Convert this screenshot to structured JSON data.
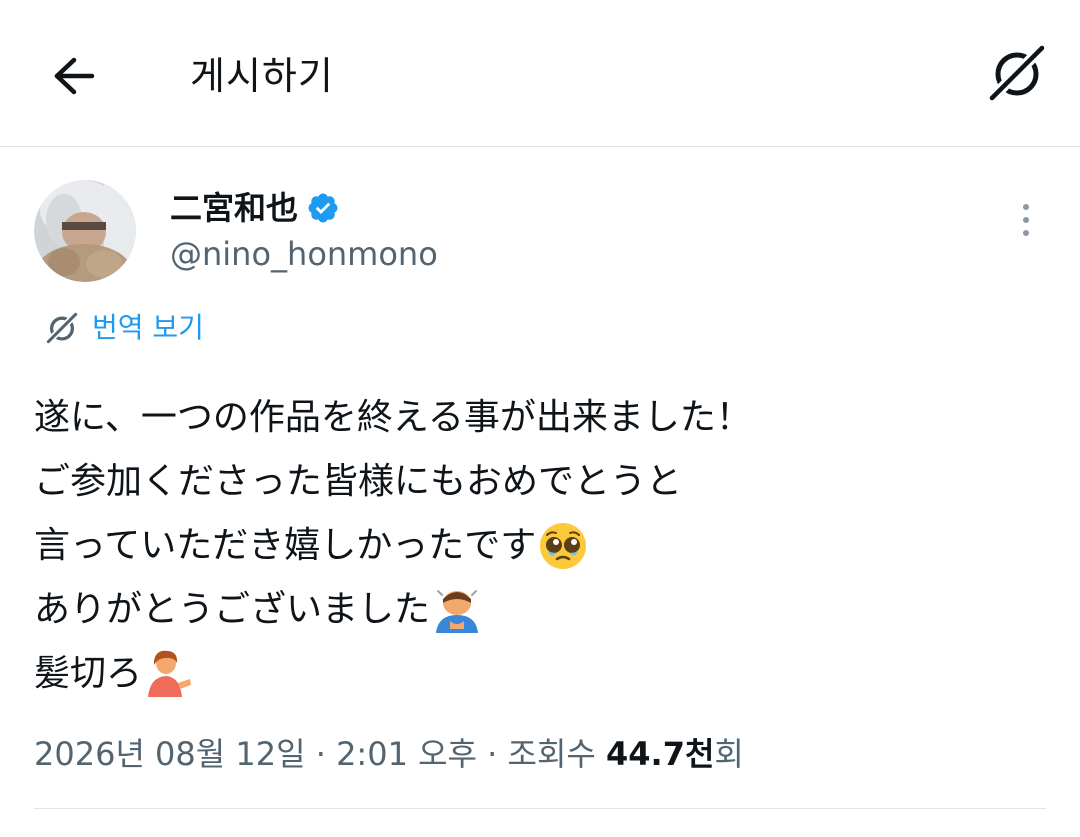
{
  "header": {
    "title": "게시하기",
    "back_icon": "arrow-left-icon",
    "grok_icon": "grok-icon"
  },
  "post": {
    "author": {
      "name": "二宮和也",
      "handle": "@nino_honmono",
      "verified": true,
      "verified_color": "#1d9bf0"
    },
    "translate_label": "번역 보기",
    "lines": [
      {
        "text": "遂に、一つの作品を終える事が出来ました！",
        "emoji": ""
      },
      {
        "text": "ご参加くださった皆様にもおめでとうと",
        "emoji": ""
      },
      {
        "text": "言っていただき嬉しかったです",
        "emoji": "pleading-face"
      },
      {
        "text": "ありがとうございました",
        "emoji": "person-bowing"
      },
      {
        "text": "髪切ろ",
        "emoji": "person-tipping-hand"
      }
    ],
    "meta": {
      "date": "2026년 08월 12일",
      "separator": "·",
      "time": "2:01 오후",
      "views_label": "조회수",
      "views_count": "44.7천",
      "views_suffix": "회"
    }
  },
  "colors": {
    "accent": "#1d9bf0",
    "text_primary": "#0f1419",
    "text_secondary": "#536471",
    "divider": "#e1e4e8"
  }
}
